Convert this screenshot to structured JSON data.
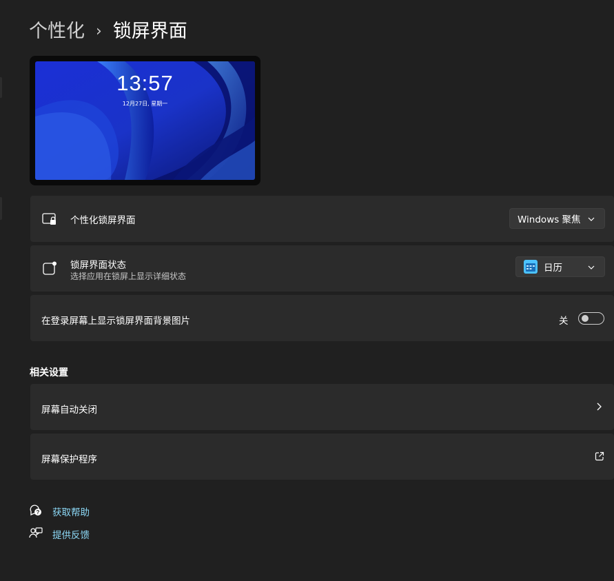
{
  "breadcrumb": {
    "parent": "个性化",
    "separator": "›",
    "current": "锁屏界面"
  },
  "preview": {
    "time": "13:57",
    "date": "12月27日, 星期一"
  },
  "settings": {
    "personalize": {
      "title": "个性化锁屏界面",
      "value": "Windows 聚焦",
      "icon": "lock-screen-icon"
    },
    "status": {
      "title": "锁屏界面状态",
      "subtitle": "选择应用在锁屏上显示详细状态",
      "value": "日历",
      "icon": "status-notification-icon",
      "app_icon": "calendar-icon"
    },
    "signin_background": {
      "title": "在登录屏幕上显示锁屏界面背景图片",
      "state_label": "关",
      "on": false
    }
  },
  "related": {
    "title": "相关设置",
    "items": [
      {
        "label": "屏幕自动关闭",
        "icon": "chevron-right-icon"
      },
      {
        "label": "屏幕保护程序",
        "icon": "external-link-icon"
      }
    ]
  },
  "help": {
    "get_help": "获取帮助",
    "feedback": "提供反馈"
  },
  "colors": {
    "background": "#202020",
    "card": "#2b2b2b",
    "link": "#8cd8f6",
    "calendar_accent": "#4cc2ff"
  }
}
